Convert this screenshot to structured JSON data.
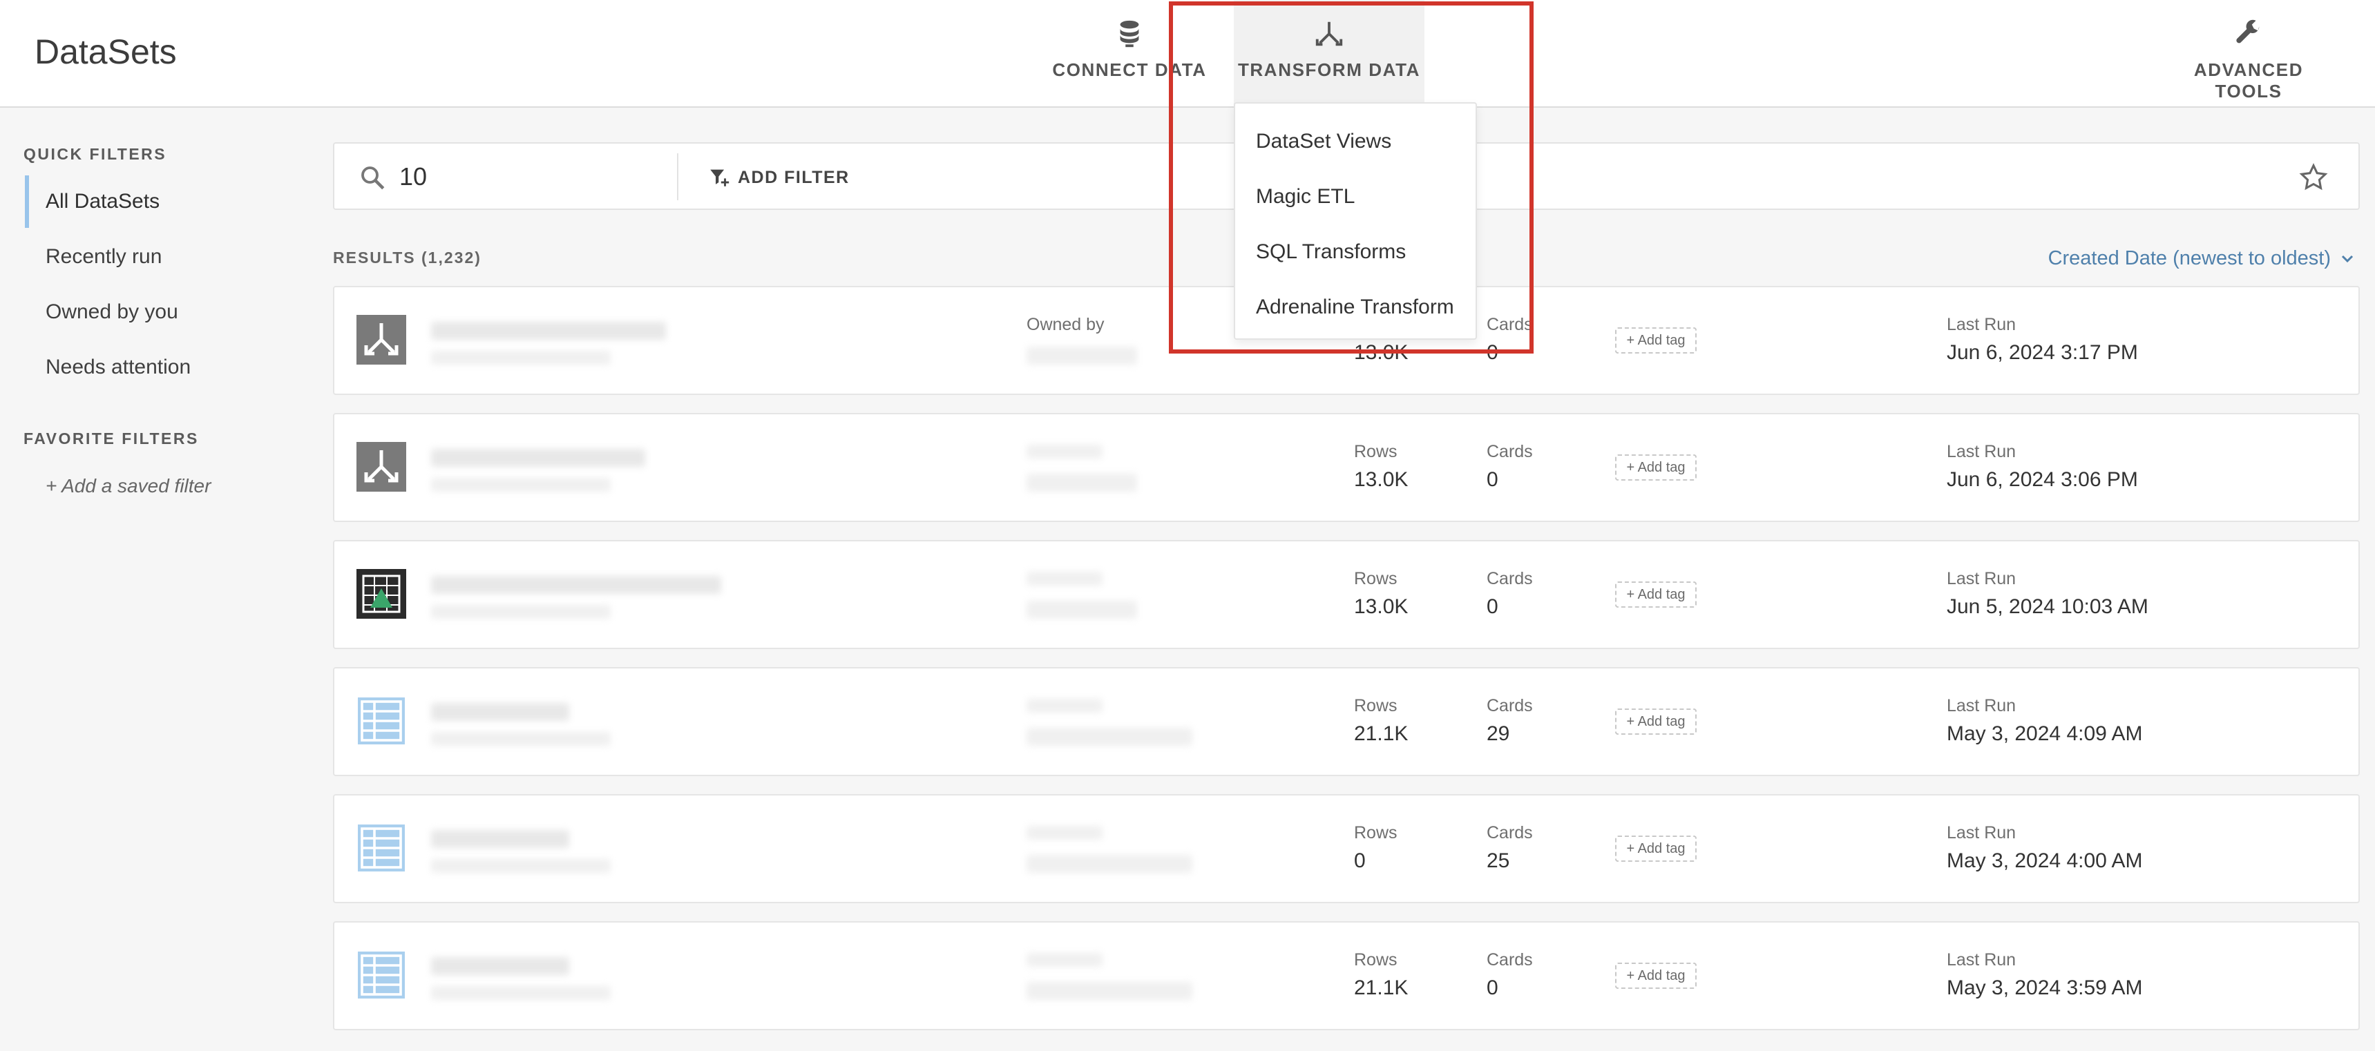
{
  "header": {
    "title": "DataSets",
    "nav": [
      {
        "label": "CONNECT DATA",
        "icon": "database-icon"
      },
      {
        "label": "TRANSFORM DATA",
        "icon": "merge-arrows-icon"
      },
      {
        "label": "ADVANCED TOOLS",
        "icon": "wrench-icon"
      }
    ]
  },
  "transform_menu": {
    "items": [
      "DataSet Views",
      "Magic ETL",
      "SQL Transforms",
      "Adrenaline Transform"
    ]
  },
  "sidebar": {
    "quick_filters_heading": "QUICK FILTERS",
    "quick_filters": [
      "All DataSets",
      "Recently run",
      "Owned by you",
      "Needs attention"
    ],
    "favorite_filters_heading": "FAVORITE FILTERS",
    "add_saved_filter": "+ Add a saved filter"
  },
  "search": {
    "value": "10",
    "add_filter_label": "ADD FILTER"
  },
  "results": {
    "count_label": "RESULTS (1,232)",
    "sort_label": "Created Date (newest to oldest)"
  },
  "labels": {
    "owned_by": "Owned by",
    "rows": "Rows",
    "cards": "Cards",
    "add_tag": "+ Add tag",
    "last_run": "Last Run"
  },
  "colors": {
    "accent_blue": "#4f80ab",
    "highlight_red": "#d1352b",
    "active_filter": "#99c4eb"
  },
  "rows": [
    {
      "icon": "etl-transform-icon",
      "rows": "13.0K",
      "cards": "0",
      "last_run": "Jun 6, 2024 3:17 PM"
    },
    {
      "icon": "etl-transform-icon",
      "rows": "13.0K",
      "cards": "0",
      "last_run": "Jun 6, 2024 3:06 PM"
    },
    {
      "icon": "spreadsheet-connector-icon",
      "rows": "13.0K",
      "cards": "0",
      "last_run": "Jun 5, 2024 10:03 AM"
    },
    {
      "icon": "table-icon",
      "rows": "21.1K",
      "cards": "29",
      "last_run": "May 3, 2024 4:09 AM"
    },
    {
      "icon": "table-icon",
      "rows": "0",
      "cards": "25",
      "last_run": "May 3, 2024 4:00 AM"
    },
    {
      "icon": "table-icon",
      "rows": "21.1K",
      "cards": "0",
      "last_run": "May 3, 2024 3:59 AM"
    }
  ]
}
